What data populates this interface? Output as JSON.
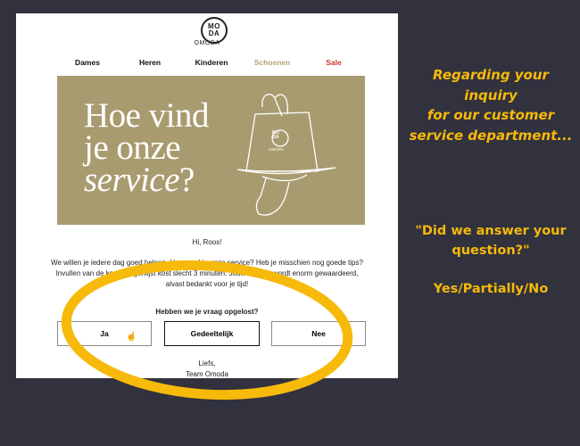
{
  "email": {
    "logo": {
      "mark_lines": [
        "MO",
        "DA"
      ],
      "wordmark": "OMODA"
    },
    "nav": [
      {
        "label": "Dames",
        "color": "#111111"
      },
      {
        "label": "Heren",
        "color": "#111111"
      },
      {
        "label": "Kinderen",
        "color": "#111111"
      },
      {
        "label": "Schoenen",
        "color": "#b5a27a"
      },
      {
        "label": "Sale",
        "color": "#d0312d"
      }
    ],
    "banner": {
      "line1": "Hoe vind",
      "line2": "je onze",
      "line3": "service",
      "line3_suffix": "?",
      "bag_logo": [
        "MO",
        "DA"
      ],
      "bag_wordmark": "OMODA",
      "background": "#a89b6f"
    },
    "greeting": "Hi, Roos!",
    "paragraph": [
      "We willen je iedere dag goed helpen. Hoe vond je onze service? Heb je misschien nog goede tips?",
      "Invullen van de korte vragenlijst kost slecht 3 minuten. Jouw mening wordt enorm gewaardeerd,",
      "alvast bedankt voor je tijd!"
    ],
    "question": "Hebben we je vraag opgelost?",
    "buttons": [
      "Ja",
      "Gedeeltelijk",
      "Nee"
    ],
    "signoff": [
      "Liefs,",
      "Team Omoda"
    ]
  },
  "annotation": {
    "heading_lines": [
      "Regarding your",
      "inquiry",
      "for our customer",
      "service department..."
    ],
    "quote_lines": [
      "\"Did we answer your",
      "question?\""
    ],
    "options": "Yes/Partially/No",
    "highlight_color": "#f7b90a"
  }
}
